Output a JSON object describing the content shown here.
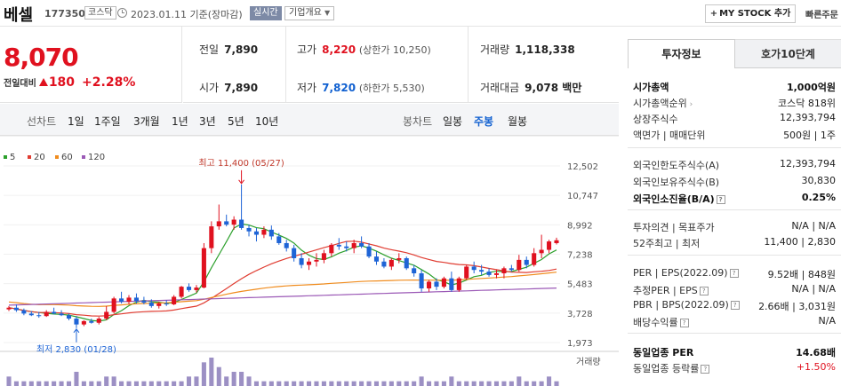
{
  "header": {
    "name": "베셀",
    "code": "177350",
    "market": "코스닥",
    "date_text": "2023.01.11  기준(장마감)",
    "realtime_label": "실시간",
    "overview_label": "기업개요",
    "mystock_label": "MY STOCK 추가",
    "quick_order_label": "빠른주문"
  },
  "price": {
    "current": "8,070",
    "change_label": "전일대비",
    "change": "180",
    "change_pct": "+2.28%",
    "prev_close_label": "전일",
    "prev_close": "7,890",
    "high_label": "고가",
    "high": "8,220",
    "upper_limit": "(상한가 10,250)",
    "volume_label": "거래량",
    "volume": "1,118,338",
    "open_label": "시가",
    "open": "7,890",
    "low_label": "저가",
    "low": "7,820",
    "lower_limit": "(하한가 5,530)",
    "amount_label": "거래대금",
    "amount": "9,078 백만"
  },
  "chart_tabs": {
    "line_label": "선차트",
    "line_items": [
      "1일",
      "1주일",
      "3개월",
      "1년",
      "3년",
      "5년",
      "10년"
    ],
    "candle_label": "봉차트",
    "candle_items": [
      "일봉",
      "주봉",
      "월봉"
    ],
    "active": "주봉"
  },
  "chart_data": {
    "type": "candlestick",
    "legend": [
      {
        "name": "5",
        "color": "#2ca02c"
      },
      {
        "name": "20",
        "color": "#e03c31"
      },
      {
        "name": "60",
        "color": "#f08c1e"
      },
      {
        "name": "120",
        "color": "#9b59b6"
      }
    ],
    "y_ticks": [
      "12,502",
      "10,747",
      "8,992",
      "7,238",
      "5,483",
      "3,728",
      "1,973"
    ],
    "ylim": [
      1973,
      12502
    ],
    "max_annotation": "최고 11,400 (05/27)",
    "min_annotation": "최저 2,830 (01/28)",
    "volume_label": "거래량",
    "candles": [
      {
        "o": 3950,
        "h": 4150,
        "l": 3850,
        "c": 4050
      },
      {
        "o": 4050,
        "h": 4250,
        "l": 3800,
        "c": 3900
      },
      {
        "o": 3900,
        "h": 4000,
        "l": 3600,
        "c": 3700
      },
      {
        "o": 3700,
        "h": 3850,
        "l": 3550,
        "c": 3600
      },
      {
        "o": 3600,
        "h": 3800,
        "l": 3450,
        "c": 3550
      },
      {
        "o": 3550,
        "h": 3900,
        "l": 3500,
        "c": 3800
      },
      {
        "o": 3800,
        "h": 4050,
        "l": 3650,
        "c": 3700
      },
      {
        "o": 3700,
        "h": 3900,
        "l": 3550,
        "c": 3600
      },
      {
        "o": 3600,
        "h": 3700,
        "l": 3300,
        "c": 3400
      },
      {
        "o": 3400,
        "h": 3550,
        "l": 2830,
        "c": 3050
      },
      {
        "o": 3050,
        "h": 3300,
        "l": 2950,
        "c": 3250
      },
      {
        "o": 3250,
        "h": 3400,
        "l": 3100,
        "c": 3150
      },
      {
        "o": 3150,
        "h": 3500,
        "l": 3050,
        "c": 3400
      },
      {
        "o": 3400,
        "h": 4150,
        "l": 3300,
        "c": 3800
      },
      {
        "o": 3800,
        "h": 4700,
        "l": 3700,
        "c": 4600
      },
      {
        "o": 4600,
        "h": 5000,
        "l": 4300,
        "c": 4400
      },
      {
        "o": 4400,
        "h": 4800,
        "l": 4250,
        "c": 4650
      },
      {
        "o": 4650,
        "h": 4900,
        "l": 4300,
        "c": 4450
      },
      {
        "o": 4450,
        "h": 4700,
        "l": 4250,
        "c": 4350
      },
      {
        "o": 4350,
        "h": 4550,
        "l": 4050,
        "c": 4150
      },
      {
        "o": 4150,
        "h": 4400,
        "l": 4000,
        "c": 4300
      },
      {
        "o": 4300,
        "h": 4500,
        "l": 4150,
        "c": 4250
      },
      {
        "o": 4250,
        "h": 4800,
        "l": 4200,
        "c": 4700
      },
      {
        "o": 4700,
        "h": 5350,
        "l": 4600,
        "c": 5300
      },
      {
        "o": 5300,
        "h": 5500,
        "l": 5000,
        "c": 5100
      },
      {
        "o": 5100,
        "h": 5400,
        "l": 4950,
        "c": 5250
      },
      {
        "o": 5250,
        "h": 7900,
        "l": 5200,
        "c": 7600
      },
      {
        "o": 7600,
        "h": 9200,
        "l": 7300,
        "c": 8900
      },
      {
        "o": 8900,
        "h": 10200,
        "l": 8700,
        "c": 9200
      },
      {
        "o": 9200,
        "h": 9600,
        "l": 8900,
        "c": 9000
      },
      {
        "o": 9000,
        "h": 9500,
        "l": 8700,
        "c": 9300
      },
      {
        "o": 9300,
        "h": 11400,
        "l": 8700,
        "c": 8800
      },
      {
        "o": 8800,
        "h": 9000,
        "l": 8300,
        "c": 8600
      },
      {
        "o": 8600,
        "h": 8800,
        "l": 8000,
        "c": 8400
      },
      {
        "o": 8400,
        "h": 8900,
        "l": 8200,
        "c": 8700
      },
      {
        "o": 8700,
        "h": 8950,
        "l": 8100,
        "c": 8300
      },
      {
        "o": 8300,
        "h": 8500,
        "l": 7800,
        "c": 7900
      },
      {
        "o": 7900,
        "h": 8100,
        "l": 7400,
        "c": 7600
      },
      {
        "o": 7600,
        "h": 7800,
        "l": 6800,
        "c": 7000
      },
      {
        "o": 7000,
        "h": 7300,
        "l": 6400,
        "c": 6600
      },
      {
        "o": 6600,
        "h": 7000,
        "l": 6300,
        "c": 6800
      },
      {
        "o": 6800,
        "h": 7300,
        "l": 6500,
        "c": 6900
      },
      {
        "o": 6900,
        "h": 7500,
        "l": 6700,
        "c": 7300
      },
      {
        "o": 7300,
        "h": 7900,
        "l": 7100,
        "c": 7800
      },
      {
        "o": 7800,
        "h": 8200,
        "l": 7500,
        "c": 7700
      },
      {
        "o": 7700,
        "h": 8000,
        "l": 7400,
        "c": 7600
      },
      {
        "o": 7600,
        "h": 8100,
        "l": 7300,
        "c": 7900
      },
      {
        "o": 7900,
        "h": 8300,
        "l": 7600,
        "c": 7700
      },
      {
        "o": 7700,
        "h": 7900,
        "l": 7000,
        "c": 7100
      },
      {
        "o": 7100,
        "h": 7400,
        "l": 6600,
        "c": 6800
      },
      {
        "o": 6800,
        "h": 7000,
        "l": 6400,
        "c": 6500
      },
      {
        "o": 6500,
        "h": 7000,
        "l": 6300,
        "c": 6900
      },
      {
        "o": 6900,
        "h": 7300,
        "l": 6700,
        "c": 7000
      },
      {
        "o": 7000,
        "h": 7100,
        "l": 6300,
        "c": 6400
      },
      {
        "o": 6400,
        "h": 6600,
        "l": 5900,
        "c": 6100
      },
      {
        "o": 6100,
        "h": 6300,
        "l": 5000,
        "c": 5200
      },
      {
        "o": 5200,
        "h": 5700,
        "l": 5000,
        "c": 5600
      },
      {
        "o": 5600,
        "h": 5800,
        "l": 5100,
        "c": 5300
      },
      {
        "o": 5300,
        "h": 5900,
        "l": 5200,
        "c": 5800
      },
      {
        "o": 5800,
        "h": 6200,
        "l": 5000,
        "c": 5100
      },
      {
        "o": 5100,
        "h": 5900,
        "l": 5000,
        "c": 5800
      },
      {
        "o": 5800,
        "h": 6600,
        "l": 5700,
        "c": 6500
      },
      {
        "o": 6500,
        "h": 6800,
        "l": 6100,
        "c": 6300
      },
      {
        "o": 6300,
        "h": 6600,
        "l": 6000,
        "c": 6200
      },
      {
        "o": 6200,
        "h": 6400,
        "l": 5900,
        "c": 6000
      },
      {
        "o": 6000,
        "h": 6300,
        "l": 5800,
        "c": 6100
      },
      {
        "o": 6100,
        "h": 6500,
        "l": 5800,
        "c": 6400
      },
      {
        "o": 6400,
        "h": 6600,
        "l": 6200,
        "c": 6300
      },
      {
        "o": 6300,
        "h": 7200,
        "l": 6200,
        "c": 6900
      },
      {
        "o": 6900,
        "h": 7100,
        "l": 6400,
        "c": 6600
      },
      {
        "o": 6600,
        "h": 7600,
        "l": 6500,
        "c": 7300
      },
      {
        "o": 7300,
        "h": 8400,
        "l": 7000,
        "c": 7500
      },
      {
        "o": 7500,
        "h": 8100,
        "l": 7300,
        "c": 8000
      },
      {
        "o": 7900,
        "h": 8220,
        "l": 7820,
        "c": 8070
      }
    ],
    "volumes": [
      2,
      1,
      1,
      1,
      1,
      1,
      1,
      1,
      1,
      3,
      1,
      1,
      1,
      2,
      2,
      1,
      1,
      1,
      1,
      1,
      1,
      1,
      1,
      1,
      2,
      2,
      5,
      6,
      4,
      2,
      3,
      3,
      2,
      1,
      1,
      1,
      1,
      1,
      1,
      1,
      1,
      1,
      1,
      1,
      1,
      1,
      1,
      1,
      1,
      1,
      1,
      1,
      1,
      1,
      1,
      2,
      1,
      1,
      1,
      2,
      1,
      1,
      1,
      1,
      1,
      1,
      1,
      1,
      2,
      1,
      1,
      1,
      2,
      1
    ]
  },
  "right_panel": {
    "tab_active": "투자정보",
    "tab_other": "호가10단계",
    "rows": [
      {
        "k": "시가총액",
        "v": "1,000억원",
        "bold": true
      },
      {
        "k": "시가총액순위",
        "v": "코스닥 818위",
        "arrow": true
      },
      {
        "k": "상장주식수",
        "v": "12,393,794"
      },
      {
        "k": "액면가 | 매매단위",
        "v": "500원 | 1주"
      },
      {
        "k": "외국인한도주식수(A)",
        "v": "12,393,794"
      },
      {
        "k": "외국인보유주식수(B)",
        "v": "30,830"
      },
      {
        "k": "외국인소진율(B/A)",
        "v": "0.25%",
        "bold": true,
        "q": true
      },
      {
        "k": "투자의견 | 목표주가",
        "v": "N/A | N/A"
      },
      {
        "k": "52주최고 | 최저",
        "v": "11,400 | 2,830"
      },
      {
        "k": "PER | EPS(2022.09)",
        "v": "9.52배 | 848원",
        "q": true
      },
      {
        "k": "추정PER | EPS",
        "v": "N/A | N/A",
        "q": true
      },
      {
        "k": "PBR | BPS(2022.09)",
        "v": "2.66배 | 3,031원",
        "q": true
      },
      {
        "k": "배당수익률",
        "v": "N/A",
        "q": true
      },
      {
        "k": "동일업종 PER",
        "v": "14.68배",
        "bold": true
      },
      {
        "k": "동일업종 등락률",
        "v": "+1.50%",
        "q": true,
        "red": true
      }
    ]
  }
}
